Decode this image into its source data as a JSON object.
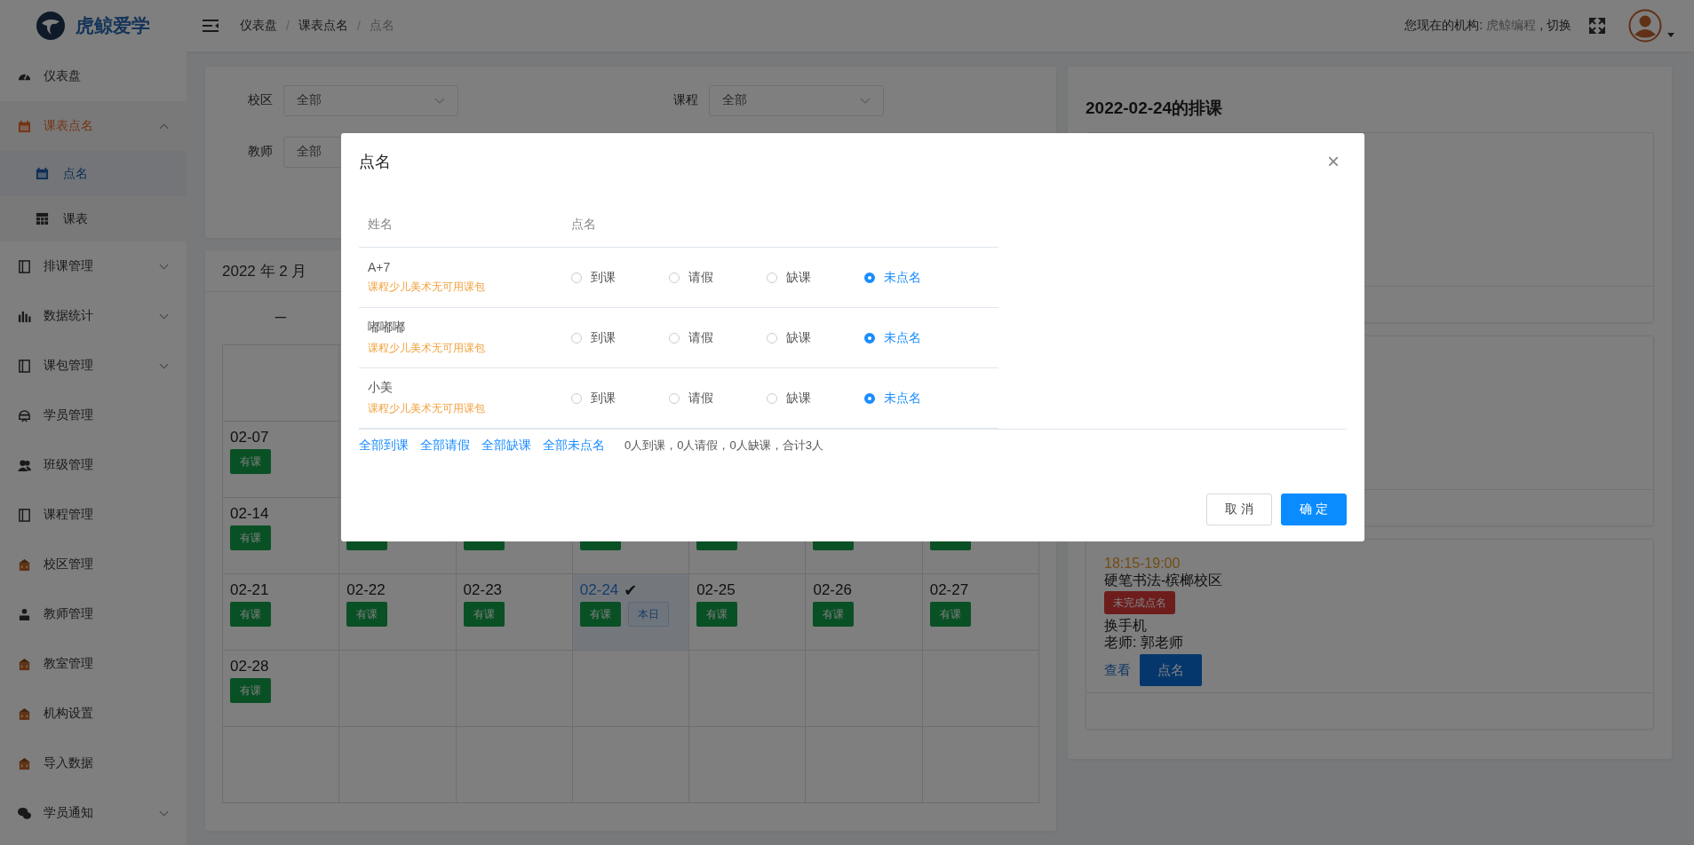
{
  "brand": {
    "name": "虎鲸爱学"
  },
  "breadcrumb": {
    "separator": "/",
    "items": [
      {
        "label": "仪表盘",
        "current": false
      },
      {
        "label": "课表点名",
        "current": false
      },
      {
        "label": "点名",
        "current": true
      }
    ]
  },
  "org": {
    "label": "您现在的机构:",
    "name": "虎鲸编程",
    "switch": ", 切换"
  },
  "sidebar": {
    "items": [
      {
        "label": "仪表盘",
        "selected": false
      },
      {
        "label": "课表点名",
        "selected": true,
        "expanded": true,
        "children": [
          {
            "label": "点名",
            "selected": true
          },
          {
            "label": "课表",
            "selected": false
          }
        ]
      },
      {
        "label": "排课管理",
        "selected": false,
        "expanded": false
      },
      {
        "label": "数据统计",
        "selected": false,
        "expanded": false
      },
      {
        "label": "课包管理",
        "selected": false,
        "expanded": false
      },
      {
        "label": "学员管理",
        "selected": false
      },
      {
        "label": "班级管理",
        "selected": false
      },
      {
        "label": "课程管理",
        "selected": false
      },
      {
        "label": "校区管理",
        "selected": false
      },
      {
        "label": "教师管理",
        "selected": false
      },
      {
        "label": "教室管理",
        "selected": false
      },
      {
        "label": "机构设置",
        "selected": false
      },
      {
        "label": "导入数据",
        "selected": false
      },
      {
        "label": "学员通知",
        "selected": false,
        "expanded": false
      }
    ]
  },
  "filters": [
    {
      "label": "校区",
      "value": "全部"
    },
    {
      "label": "课程",
      "value": "全部"
    },
    {
      "label": "教师",
      "value": "全部"
    }
  ],
  "calendar": {
    "title": "2022 年 2 月",
    "weekdays": [
      "一"
    ],
    "weeks": [
      [
        {
          "date": "02-07",
          "badge": "有课"
        }
      ],
      [
        {
          "date": "02-14",
          "badge": "有课"
        },
        {
          "has_course": true
        },
        {
          "has_course": true
        },
        {
          "has_course": true
        },
        {
          "has_course": true
        },
        {
          "has_course": true
        },
        {
          "has_course": true
        }
      ],
      [
        {
          "date": "02-21",
          "badge": "有课"
        },
        {
          "date": "02-22",
          "badge": "有课"
        },
        {
          "date": "02-23",
          "badge": "有课"
        },
        {
          "date": "02-24",
          "badge": "有课",
          "today": true,
          "check": "✔",
          "tag": "本日"
        },
        {
          "date": "02-25",
          "badge": "有课"
        },
        {
          "date": "02-26",
          "badge": "有课"
        },
        {
          "date": "02-27",
          "badge": "有课"
        }
      ],
      [
        {
          "date": "02-28",
          "badge": "有课"
        }
      ]
    ]
  },
  "schedule": {
    "title": "2022-02-24的排课",
    "cards": [
      {
        "time": "18:15-19:00",
        "course": "硬笔书法-槟榔校区",
        "status": "未完成点名",
        "name": "换手机",
        "teacher": "老师: 郭老师",
        "view": "查看",
        "action": "点名"
      }
    ]
  },
  "dialog": {
    "title": "点名",
    "close": "×",
    "columns": [
      "姓名",
      "点名"
    ],
    "rows": [
      {
        "name": "A+7",
        "note": "课程少儿美术无可用课包",
        "options": [
          {
            "label": "到课",
            "selected": false
          },
          {
            "label": "请假",
            "selected": false
          },
          {
            "label": "缺课",
            "selected": false
          },
          {
            "label": "未点名",
            "selected": true
          }
        ]
      },
      {
        "name": "嘟嘟嘟",
        "note": "课程少儿美术无可用课包",
        "options": [
          {
            "label": "到课",
            "selected": false
          },
          {
            "label": "请假",
            "selected": false
          },
          {
            "label": "缺课",
            "selected": false
          },
          {
            "label": "未点名",
            "selected": true
          }
        ]
      },
      {
        "name": "小美",
        "note": "课程少儿美术无可用课包",
        "options": [
          {
            "label": "到课",
            "selected": false
          },
          {
            "label": "请假",
            "selected": false
          },
          {
            "label": "缺课",
            "selected": false
          },
          {
            "label": "未点名",
            "selected": true
          }
        ]
      }
    ],
    "bulk": [
      "全部到课",
      "全部请假",
      "全部缺课",
      "全部未点名"
    ],
    "summary": "0人到课，0人请假，0人缺课，合计3人",
    "cancel": "取 消",
    "confirm": "确 定"
  }
}
